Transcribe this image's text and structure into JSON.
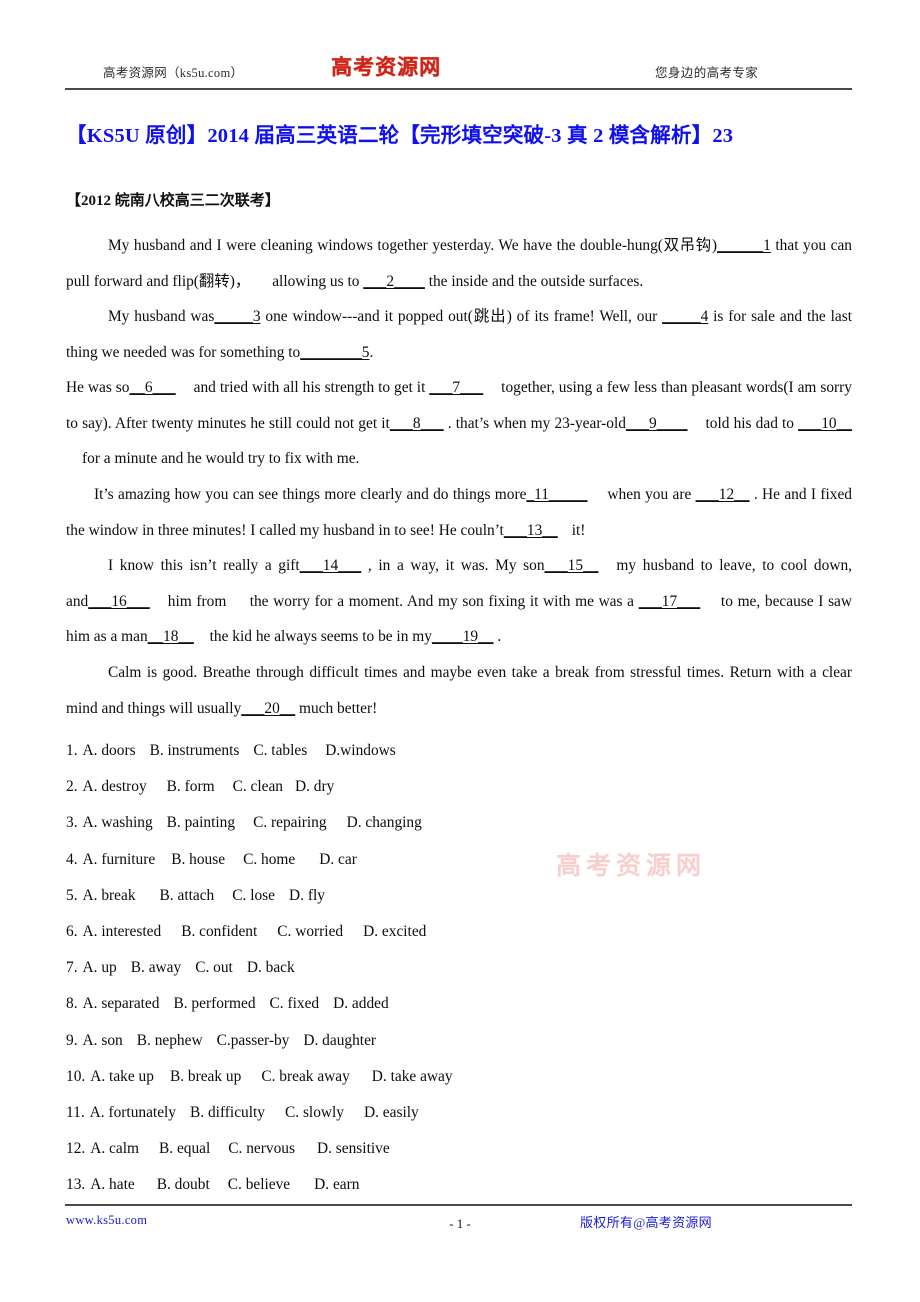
{
  "header": {
    "left_text": "高考资源网（ks5u.com）",
    "logo_text": "高考资源网",
    "right_text": "您身边的高考专家"
  },
  "title": "【KS5U 原创】2014 届高三英语二轮【完形填空突破-3 真 2 模含解析】23",
  "subtitle": "【2012 皖南八校高三二次联考】",
  "passage": {
    "p1_a": "My husband and I were cleaning windows together yesterday. We have the double-hung(双吊钩)",
    "p1_blank1": "______1",
    "p1_b": " that you can pull forward and flip(翻转)，",
    "p1_c": "allowing us to ",
    "p1_blank2": "___2____",
    "p1_d": " the inside and the outside surfaces.",
    "p2_a": "My husband was",
    "p2_blank3": "_____3",
    "p2_b": " one window---and it popped out(跳出) of its frame! Well, our ",
    "p2_blank4": "_____4",
    "p2_c": " is for sale and the last thing we needed was for something to",
    "p2_blank5": "________5",
    "p2_d": ".",
    "p3_a": "He was so",
    "p3_blank6": "__6___",
    "p3_b": "and tried with all his strength to get it ",
    "p3_blank7": "___7___",
    "p3_c": "together, using a few less than pleasant words(I am sorry to say). After twenty minutes he still could not get it",
    "p3_blank8": "___8___",
    "p3_d": " . that’s when my 23-year-old",
    "p3_blank9": "___9____",
    "p3_e": "told his dad to ",
    "p3_blank10": "___10__",
    "p3_f": "for a minute and he would try to fix with me.",
    "p4_a": "It’s amazing how you can see things more clearly and do things more",
    "p4_blank11": "_11_____",
    "p4_b": "when you are ",
    "p4_blank12": "___12__",
    "p4_c": " . He and I fixed the window in three minutes! I called my husband in to see! He couln’t",
    "p4_blank13": "___13__",
    "p4_d": "it!",
    "p5_a": "I know this isn’t really a gift",
    "p5_blank14": "___14___",
    "p5_b": " , in a way, it was. My son",
    "p5_blank15": "___15__",
    "p5_c": "my husband to leave, to cool down, and",
    "p5_blank16": "___16___",
    "p5_d": "him from ",
    "p5_e": " the worry for a moment. And my son fixing it with me was a ",
    "p5_blank17": "___17___",
    "p5_f": " to me, because I saw him as a man",
    "p5_blank18": "__18__",
    "p5_g": " the kid he always seems to be in my",
    "p5_blank19": "____19__",
    "p5_h": " .",
    "p6_a": "Calm is good. Breathe through difficult times and maybe even take a break from stressful times. Return with a clear mind and things will usually",
    "p6_blank20": "___20__",
    "p6_b": " much better!"
  },
  "options": [
    {
      "num": "1.",
      "items": [
        "A. doors",
        "B. instruments",
        "C. tables",
        "D.windows"
      ]
    },
    {
      "num": "2.",
      "items": [
        "A. destroy",
        "B. form",
        "C. clean",
        "D. dry"
      ]
    },
    {
      "num": "3.",
      "items": [
        "A. washing",
        "B. painting",
        "C. repairing",
        "D. changing"
      ]
    },
    {
      "num": "4.",
      "items": [
        "A. furniture",
        "B. house",
        "C. home",
        "D. car"
      ]
    },
    {
      "num": "5.",
      "items": [
        "A. break",
        "B. attach",
        "C. lose",
        "D. fly"
      ]
    },
    {
      "num": "6.",
      "items": [
        "A. interested",
        "B. confident",
        "C. worried",
        "D. excited"
      ]
    },
    {
      "num": "7.",
      "items": [
        "A. up",
        "B. away",
        "C. out",
        "D. back"
      ]
    },
    {
      "num": "8.",
      "items": [
        "A. separated",
        "B. performed",
        "C. fixed",
        "D. added"
      ]
    },
    {
      "num": "9.",
      "items": [
        "A. son",
        "B. nephew",
        "C.passer-by",
        "D. daughter"
      ]
    },
    {
      "num": "10.",
      "items": [
        "A. take up",
        "B. break up",
        "C. break away",
        "D. take away"
      ]
    },
    {
      "num": "11.",
      "items": [
        "A. fortunately",
        "B. difficulty",
        "C. slowly",
        "D. easily"
      ]
    },
    {
      "num": "12.",
      "items": [
        "A. calm",
        "B. equal",
        "C. nervous",
        "D. sensitive"
      ]
    },
    {
      "num": "13.",
      "items": [
        "A. hate",
        "B. doubt",
        "C. believe",
        "D. earn"
      ]
    }
  ],
  "watermark": "高考资源网",
  "footer": {
    "left": "www.ks5u.com",
    "page": "- 1 -",
    "right": "版权所有@高考资源网"
  },
  "colors": {
    "title_blue": "#1010ee",
    "logo_red": "#cc2418",
    "footer_blue": "#1a1ad0",
    "watermark_pink": "#f8cfcf"
  }
}
